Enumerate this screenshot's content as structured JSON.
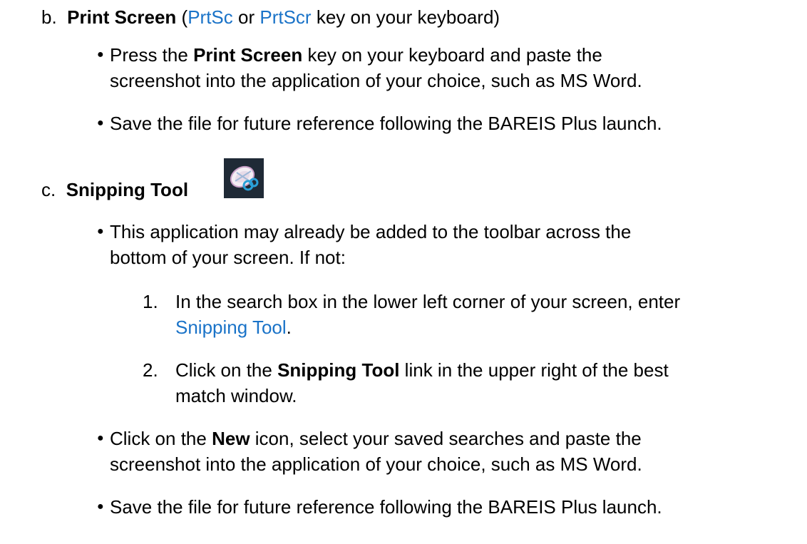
{
  "section_b": {
    "marker": "b.",
    "title": "Print Screen",
    "open_paren": " (",
    "key1": "PrtSc",
    "or_text": " or ",
    "key2": "PrtScr",
    "rest": " key on your keyboard)"
  },
  "b_bullets": [
    {
      "pre": "Press the ",
      "bold": "Print Screen",
      "post": " key on your keyboard and paste the",
      "line2": "screenshot into the application of your choice, such as MS Word."
    },
    {
      "text": "Save the file for future reference following the BAREIS Plus launch."
    }
  ],
  "section_c": {
    "marker": "c.",
    "title": "Snipping Tool",
    "icon": "snipping-tool-icon"
  },
  "c_bullets": [
    {
      "line1": "This application may already be added to the toolbar across the",
      "line2": "bottom of your screen. If not:"
    },
    {
      "pre": "Click on the ",
      "bold": "New",
      "post": " icon, select your saved searches and paste the",
      "line2": "screenshot into the application of your choice, such as MS Word."
    },
    {
      "text": "Save the file for future reference following the BAREIS Plus launch."
    }
  ],
  "steps": [
    {
      "num": "1.",
      "line1": "In the search box in the lower left corner of your screen, enter",
      "link": "Snipping Tool",
      "end": "."
    },
    {
      "num": "2.",
      "pre": "Click on the ",
      "bold": "Snipping Tool",
      "post": " link in the upper right of the best",
      "line2": "match window."
    }
  ],
  "colors": {
    "link": "#1a73c8",
    "text": "#000000",
    "icon_bg": "#1f2a36"
  }
}
